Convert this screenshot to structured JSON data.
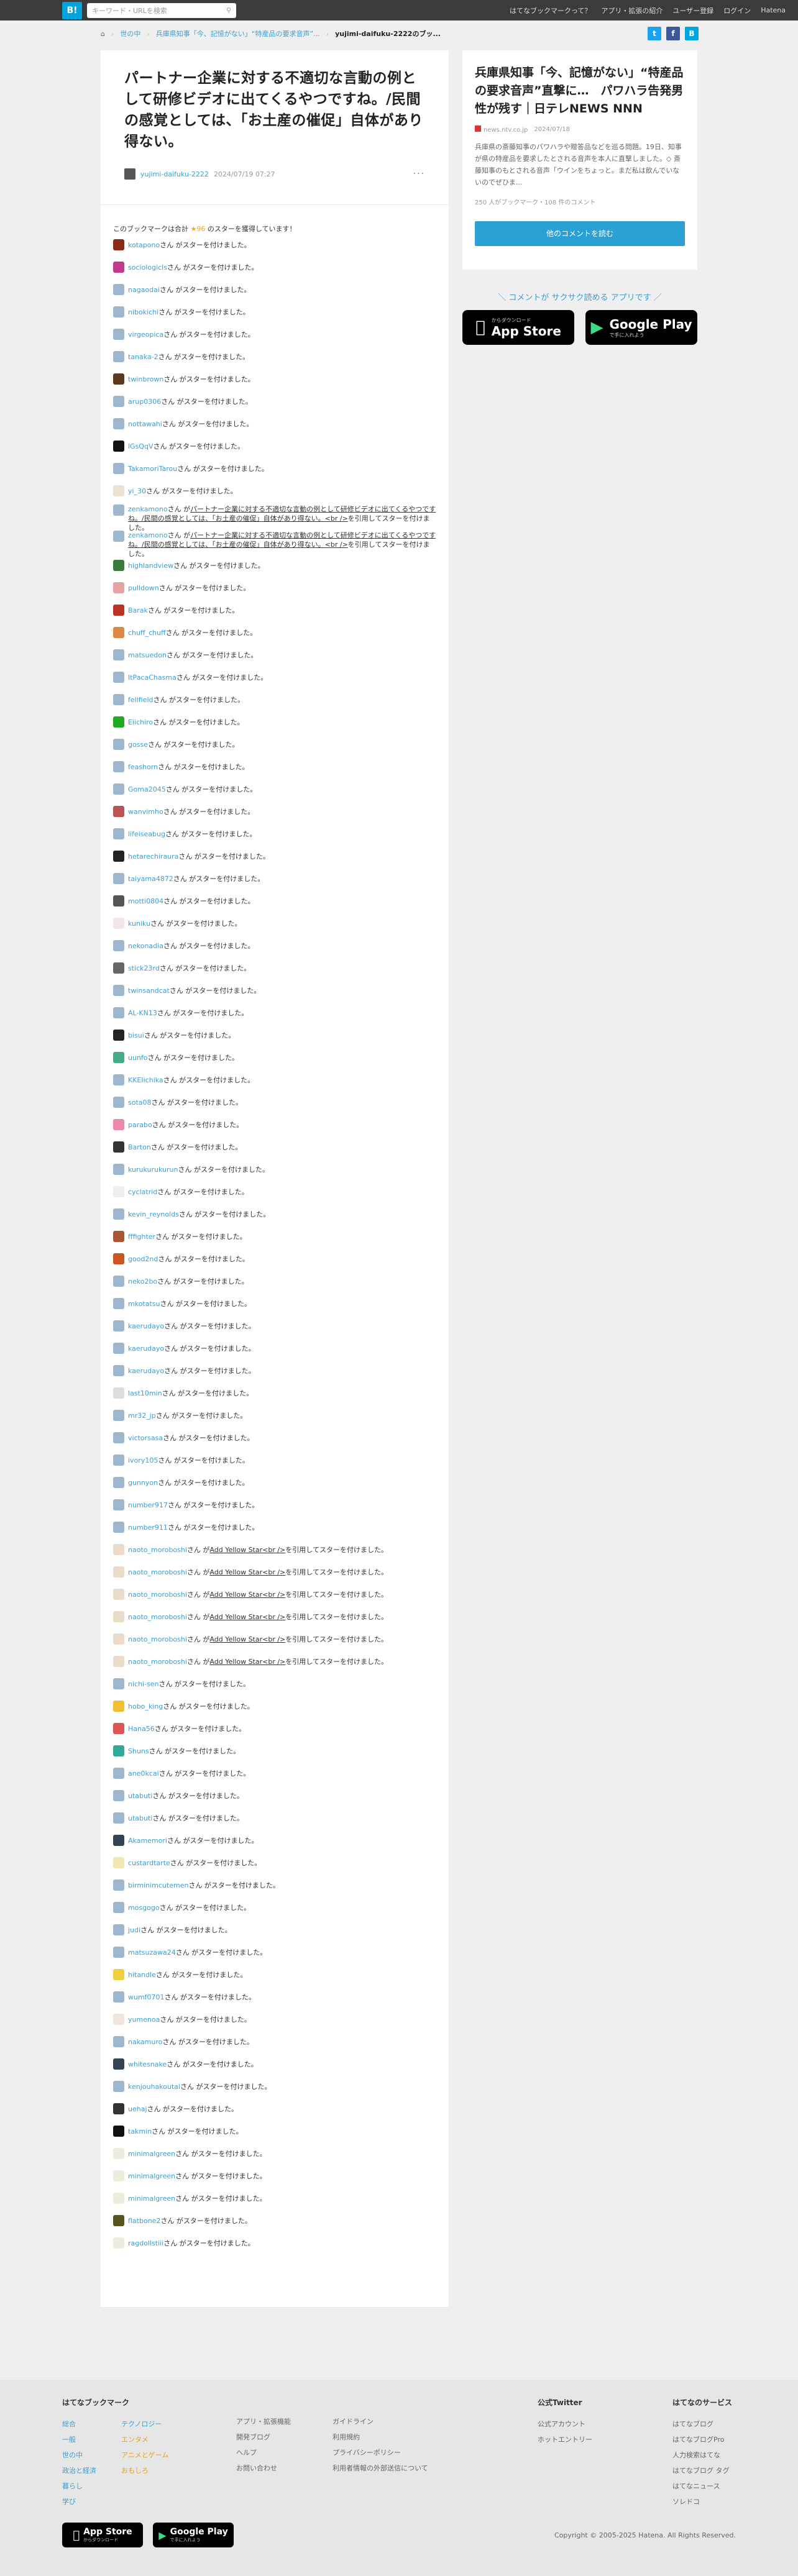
{
  "topbar": {
    "logo": "B!",
    "search_placeholder": "キーワード・URLを検索",
    "nav": [
      "はてなブックマークって？",
      "アプリ・拡張の紹介",
      "ユーザー登録",
      "ログイン",
      "Hatena"
    ]
  },
  "breadcrumb": {
    "items": [
      "世の中",
      "兵庫県知事「今、記憶がない」“特産品の要求音声”..."
    ],
    "current": "yujimi-daifuku-2222のブッ..."
  },
  "entry": {
    "title": "パートナー企業に対する不適切な言動の例として研修ビデオに出てくるやつですね。/民間の感覚としては、「お土産の催促」自体があり得ない。",
    "user": "yujimi-daifuku-2222",
    "date": "2024/07/19 07:27"
  },
  "stars": {
    "info_prefix": "このブックマークは合計",
    "count": "★96",
    "info_suffix": "のスターを獲得しています！",
    "suffix_text": "さん がスターを付けました。",
    "quote_text": "パートナー企業に対する不適切な言動の例として研修ビデオに出てくるやつですね。/民間の感覚としては、「お土産の催促」自体があり得ない。<br />",
    "quote_prefix": "さん が",
    "quote_suffix": "を引用してスターを付けました。",
    "addyellow_text": "Add Yellow Star<br />",
    "rows": [
      {
        "user": "kotapono",
        "type": "star",
        "c": "#8b2a1a"
      },
      {
        "user": "sociologicls",
        "type": "star",
        "c": "#c43a8a"
      },
      {
        "user": "nagaodai",
        "type": "star",
        "c": "#9fb6cf"
      },
      {
        "user": "nibokichi",
        "type": "star",
        "c": "#9fb6cf"
      },
      {
        "user": "virgeopica",
        "type": "star",
        "c": "#9fb6cf"
      },
      {
        "user": "tanaka-2",
        "type": "star",
        "c": "#9fb6cf"
      },
      {
        "user": "twinbrown",
        "type": "star",
        "c": "#5a3a20"
      },
      {
        "user": "arup0306",
        "type": "star",
        "c": "#9fb6cf"
      },
      {
        "user": "nottawahi",
        "type": "star",
        "c": "#9fb6cf"
      },
      {
        "user": "lGsQqV",
        "type": "star",
        "c": "#111"
      },
      {
        "user": "TakamoriTarou",
        "type": "star",
        "c": "#9fb6cf"
      },
      {
        "user": "yi_30",
        "type": "star",
        "c": "#e9e3d2"
      },
      {
        "user": "zenkamono",
        "type": "quote",
        "c": "#9fb6cf"
      },
      {
        "user": "zenkamono",
        "type": "quote",
        "c": "#9fb6cf"
      },
      {
        "user": "highlandview",
        "type": "star",
        "c": "#3a7a3a"
      },
      {
        "user": "pulldown",
        "type": "star",
        "c": "#e5a3a3"
      },
      {
        "user": "Barak",
        "type": "star",
        "c": "#b32"
      },
      {
        "user": "chuff_chuff",
        "type": "star",
        "c": "#d84"
      },
      {
        "user": "matsuedon",
        "type": "star",
        "c": "#9fb6cf"
      },
      {
        "user": "ItPacaChasma",
        "type": "star",
        "c": "#9fb6cf"
      },
      {
        "user": "fellfield",
        "type": "star",
        "c": "#9fb6cf"
      },
      {
        "user": "Eiichiro",
        "type": "star",
        "c": "#2a2"
      },
      {
        "user": "gosse",
        "type": "star",
        "c": "#9fb6cf"
      },
      {
        "user": "feashorn",
        "type": "star",
        "c": "#9fb6cf"
      },
      {
        "user": "Goma2045",
        "type": "star",
        "c": "#9fb6cf"
      },
      {
        "user": "wanvimho",
        "type": "star",
        "c": "#b55"
      },
      {
        "user": "lifeiseabug",
        "type": "star",
        "c": "#9fb6cf"
      },
      {
        "user": "hetarechiraura",
        "type": "star",
        "c": "#222"
      },
      {
        "user": "taiyama4872",
        "type": "star",
        "c": "#9fb6cf"
      },
      {
        "user": "motti0804",
        "type": "star",
        "c": "#555"
      },
      {
        "user": "kuniku",
        "type": "star",
        "c": "#f2e6e6"
      },
      {
        "user": "nekonadia",
        "type": "star",
        "c": "#9fb6cf"
      },
      {
        "user": "stick23rd",
        "type": "star",
        "c": "#666"
      },
      {
        "user": "twinsandcat",
        "type": "star",
        "c": "#9fb6cf"
      },
      {
        "user": "AL-KN13",
        "type": "star",
        "c": "#9fb6cf"
      },
      {
        "user": "bisui",
        "type": "star",
        "c": "#222"
      },
      {
        "user": "uunfo",
        "type": "star",
        "c": "#4a8"
      },
      {
        "user": "KKEIichika",
        "type": "star",
        "c": "#9fb6cf"
      },
      {
        "user": "sota08",
        "type": "star",
        "c": "#9fb6cf"
      },
      {
        "user": "parabo",
        "type": "star",
        "c": "#e8a"
      },
      {
        "user": "Barton",
        "type": "star",
        "c": "#333"
      },
      {
        "user": "kurukurukurun",
        "type": "star",
        "c": "#9fb6cf"
      },
      {
        "user": "cyclatrid",
        "type": "star",
        "c": "#eee"
      },
      {
        "user": "kevin_reynolds",
        "type": "star",
        "c": "#9fb6cf"
      },
      {
        "user": "fffighter",
        "type": "star",
        "c": "#a53"
      },
      {
        "user": "good2nd",
        "type": "star",
        "c": "#c52"
      },
      {
        "user": "neko2bo",
        "type": "star",
        "c": "#9fb6cf"
      },
      {
        "user": "mkotatsu",
        "type": "star",
        "c": "#9fb6cf"
      },
      {
        "user": "kaerudayo",
        "type": "star",
        "c": "#9fb6cf"
      },
      {
        "user": "kaerudayo",
        "type": "star",
        "c": "#9fb6cf"
      },
      {
        "user": "kaerudayo",
        "type": "star",
        "c": "#9fb6cf"
      },
      {
        "user": "last10min",
        "type": "star",
        "c": "#ddd"
      },
      {
        "user": "mr32_jp",
        "type": "star",
        "c": "#9fb6cf"
      },
      {
        "user": "victorsasa",
        "type": "star",
        "c": "#9fb6cf"
      },
      {
        "user": "ivory105",
        "type": "star",
        "c": "#9fb6cf"
      },
      {
        "user": "gunnyon",
        "type": "star",
        "c": "#9fb6cf"
      },
      {
        "user": "number917",
        "type": "star",
        "c": "#9fb6cf"
      },
      {
        "user": "number911",
        "type": "star",
        "c": "#9fb6cf"
      },
      {
        "user": "naoto_moroboshi",
        "type": "addyellow",
        "c": "#e9dcc9"
      },
      {
        "user": "naoto_moroboshi",
        "type": "addyellow",
        "c": "#e9dcc9"
      },
      {
        "user": "naoto_moroboshi",
        "type": "addyellow",
        "c": "#e9dcc9"
      },
      {
        "user": "naoto_moroboshi",
        "type": "addyellow",
        "c": "#e9dcc9"
      },
      {
        "user": "naoto_moroboshi",
        "type": "addyellow",
        "c": "#e9dcc9"
      },
      {
        "user": "naoto_moroboshi",
        "type": "addyellow",
        "c": "#e9dcc9"
      },
      {
        "user": "nichi-sen",
        "type": "star",
        "c": "#9fb6cf"
      },
      {
        "user": "hobo_king",
        "type": "star",
        "c": "#f0c030"
      },
      {
        "user": "Hana56",
        "type": "star",
        "c": "#d55"
      },
      {
        "user": "Shuns",
        "type": "star",
        "c": "#3a9"
      },
      {
        "user": "ane0kcai",
        "type": "star",
        "c": "#9fb6cf"
      },
      {
        "user": "utabuti",
        "type": "star",
        "c": "#9fb6cf"
      },
      {
        "user": "utabuti",
        "type": "star",
        "c": "#9fb6cf"
      },
      {
        "user": "Akamemori",
        "type": "star",
        "c": "#345"
      },
      {
        "user": "custardtarte",
        "type": "star",
        "c": "#f2e6b3"
      },
      {
        "user": "birminimcutemen",
        "type": "star",
        "c": "#9fb6cf"
      },
      {
        "user": "mosgogo",
        "type": "star",
        "c": "#9fb6cf"
      },
      {
        "user": "judi",
        "type": "star",
        "c": "#9fb6cf"
      },
      {
        "user": "matsuzawa24",
        "type": "star",
        "c": "#9fb6cf"
      },
      {
        "user": "hitandle",
        "type": "star",
        "c": "#f0d040"
      },
      {
        "user": "wumf0701",
        "type": "star",
        "c": "#9fb6cf"
      },
      {
        "user": "yumenoa",
        "type": "star",
        "c": "#f0e6dd"
      },
      {
        "user": "nakamuro",
        "type": "star",
        "c": "#9fb6cf"
      },
      {
        "user": "whitesnake",
        "type": "star",
        "c": "#345"
      },
      {
        "user": "kenjouhakoutai",
        "type": "star",
        "c": "#9fb6cf"
      },
      {
        "user": "uehaj",
        "type": "star",
        "c": "#333"
      },
      {
        "user": "takmin",
        "type": "star",
        "c": "#111"
      },
      {
        "user": "minimalgreen",
        "type": "star",
        "c": "#f0ecdd"
      },
      {
        "user": "minimalgreen",
        "type": "star",
        "c": "#f0ecdd"
      },
      {
        "user": "minimalgreen",
        "type": "star",
        "c": "#f0ecdd"
      },
      {
        "user": "flatbone2",
        "type": "star",
        "c": "#552"
      },
      {
        "user": "ragdollstiii",
        "type": "star",
        "c": "#f0ecdd"
      }
    ]
  },
  "side": {
    "title": "兵庫県知事「今、記憶がない」“特産品の要求音声”直撃に…　パワハラ告発男性が残す｜日テレNEWS NNN",
    "source": "news.ntv.co.jp",
    "date": "2024/07/18",
    "desc": "兵庫県の斎藤知事のパワハラや贈答品などを巡る問題。19日、知事が県の特産品を要求したとされる音声を本人に直撃しました。◇ 斎藤知事のもとされる音声「ウインをちょっと。まだ私は飲んでいないのでぜひま...",
    "count": "250 人がブックマーク・108 件のコメント",
    "more_button": "他のコメントを読む",
    "promo": "＼ コメントが サクサク読める アプリです ／"
  },
  "store": {
    "appstore_small": "からダウンロード",
    "appstore_big": "App Store",
    "google_small": "で手に入れよう",
    "google_big": "Google Play"
  },
  "footer": {
    "col1_title": "はてなブックマーク",
    "col1a": [
      "総合",
      "一般",
      "世の中",
      "政治と経済",
      "暮らし",
      "学び"
    ],
    "col1b": [
      "テクノロジー",
      "エンタメ",
      "アニメとゲーム",
      "おもしろ"
    ],
    "col2": [
      "アプリ・拡張機能",
      "開発ブログ",
      "ヘルプ",
      "お問い合わせ"
    ],
    "col3": [
      "ガイドライン",
      "利用規約",
      "プライバシーポリシー",
      "利用者情報の外部送信について"
    ],
    "col4_title": "公式Twitter",
    "col4": [
      "公式アカウント",
      "ホットエントリー"
    ],
    "col5_title": "はてなのサービス",
    "col5": [
      "はてなブログ",
      "はてなブログPro",
      "人力検索はてな",
      "はてなブログ タグ",
      "はてなニュース",
      "ソレドコ"
    ],
    "copyright": "Copyright © 2005-2025 Hatena. All Rights Reserved."
  },
  "colors": {
    "accent": "#2aa0d4",
    "link": "#3a9fcf",
    "header": "#3b3b3b",
    "star": "#f5a623"
  }
}
